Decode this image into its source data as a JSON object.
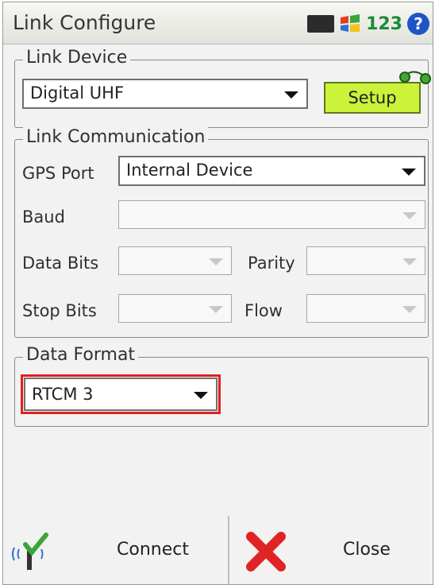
{
  "title": "Link Configure",
  "tray": {
    "input_method": "123"
  },
  "link_device": {
    "legend": "Link Device",
    "device": "Digital UHF",
    "setup_label": "Setup"
  },
  "link_communication": {
    "legend": "Link Communication",
    "gps_port_label": "GPS Port",
    "gps_port_value": "Internal Device",
    "baud_label": "Baud",
    "data_bits_label": "Data Bits",
    "parity_label": "Parity",
    "stop_bits_label": "Stop Bits",
    "flow_label": "Flow"
  },
  "data_format": {
    "legend": "Data Format",
    "value": "RTCM 3",
    "highlight_color": "#e02020"
  },
  "bottom": {
    "connect_label": "Connect",
    "close_label": "Close"
  }
}
